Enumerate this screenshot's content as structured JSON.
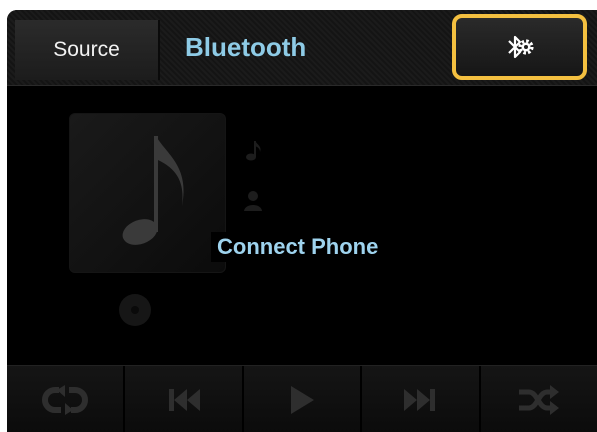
{
  "header": {
    "source_label": "Source",
    "title": "Bluetooth",
    "settings_icon": "bluetooth-settings-icon"
  },
  "main": {
    "status_text": "Connect Phone",
    "album_art_icon": "music-note-icon"
  },
  "controls": [
    {
      "name": "repeat",
      "icon": "repeat-icon"
    },
    {
      "name": "previous",
      "icon": "previous-track-icon"
    },
    {
      "name": "play",
      "icon": "play-icon"
    },
    {
      "name": "next",
      "icon": "next-track-icon"
    },
    {
      "name": "shuffle",
      "icon": "shuffle-icon"
    }
  ],
  "colors": {
    "accent_text": "#8ecbe6",
    "highlight_border": "#f4c040",
    "background": "#000000"
  }
}
